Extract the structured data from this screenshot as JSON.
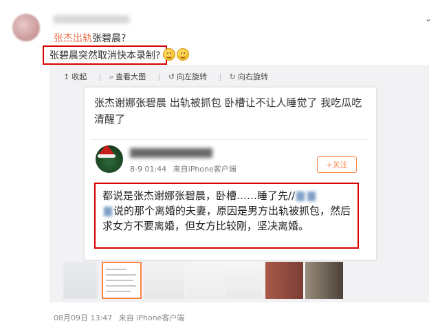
{
  "post": {
    "line1_link": "张杰出轨",
    "line1_rest": "张碧晨?",
    "line2_boxed": "张碧晨突然取消快本录制?"
  },
  "toolbar": {
    "collapse": "收起",
    "view_large": "查看大图",
    "rotate_left": "向左旋转",
    "rotate_right": "向右旋转"
  },
  "repost": {
    "text": "张杰谢娜张碧晨 出轨被抓包 卧槽让不让人睡觉了 我吃瓜吃清醒了",
    "inner": {
      "meta_time": "8-9 01:44",
      "meta_source": "来自iPhone客户端",
      "follow_label": "+关注",
      "boxed_part1": "都说是张杰谢娜张碧晨，卧槽……睡了先//",
      "boxed_part2": "说的那个离婚的夫妻，原因是男方出轨被抓包，然后求女方不要离婚，但女方比较刚，坚决离婚。"
    }
  },
  "footer": {
    "date": "08月09日 13:47",
    "source": "来自 iPhone客户端"
  },
  "colors": {
    "link": "#eb7350",
    "highlight_border": "#d80000",
    "follow": "#ff8140"
  },
  "icons": [
    "chevron-down-icon",
    "collapse-icon",
    "search-icon",
    "rotate-left-icon",
    "rotate-right-icon",
    "smile-emoji-icon"
  ]
}
